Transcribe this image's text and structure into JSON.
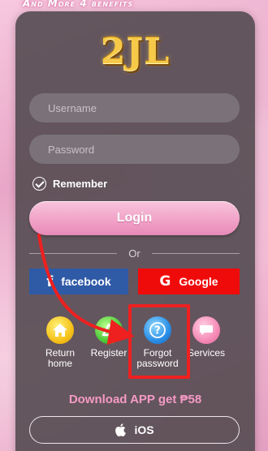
{
  "promo": {
    "text": "And More 4 benefits"
  },
  "brand": {
    "logo_text": "2JL",
    "logo_color": "#f7c948"
  },
  "form": {
    "username_placeholder": "Username",
    "password_placeholder": "Password",
    "remember_label": "Remember",
    "remember_checked": true,
    "login_label": "Login"
  },
  "divider": {
    "or_text": "Or"
  },
  "social": {
    "facebook": {
      "label": "facebook",
      "icon": "facebook-icon",
      "color": "#2f5aa6"
    },
    "google": {
      "label": "Google",
      "icon": "google-icon",
      "color": "#f00b0b"
    }
  },
  "quick_actions": [
    {
      "label": "Return home",
      "icon": "home-icon"
    },
    {
      "label": "Register",
      "icon": "register-icon"
    },
    {
      "label": "Forgot password",
      "icon": "question-icon"
    },
    {
      "label": "Services",
      "icon": "chat-icon"
    }
  ],
  "download": {
    "text": "Download APP get ₱58",
    "ios_label": "iOS",
    "accent": "#f59ac5"
  },
  "annotation": {
    "highlight_color": "#ee2020"
  }
}
